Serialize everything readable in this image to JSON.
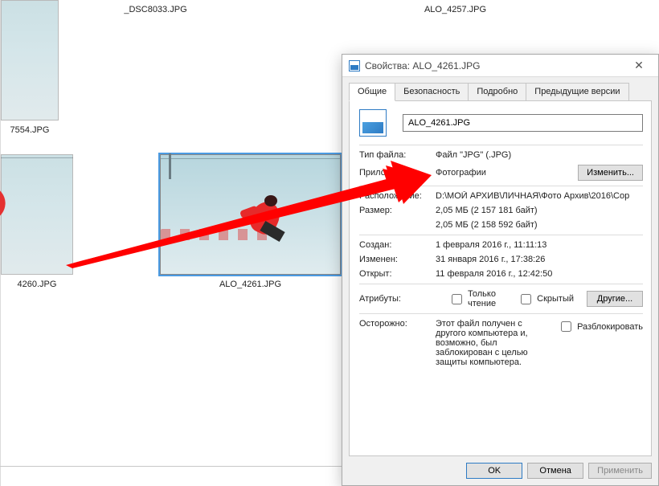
{
  "thumbs": {
    "top": [
      "7554.JPG",
      "_DSC8033.JPG",
      "ALO_4257.JPG"
    ],
    "row2_left": "4260.JPG",
    "main": "ALO_4261.JPG"
  },
  "dialog": {
    "title": "Свойства: ALO_4261.JPG",
    "tabs": [
      "Общие",
      "Безопасность",
      "Подробно",
      "Предыдущие версии"
    ],
    "filename": "ALO_4261.JPG",
    "props": {
      "type_k": "Тип файла:",
      "type_v": "Файл \"JPG\" (.JPG)",
      "app_k": "Приложение:",
      "app_v": "Фотографии",
      "change_btn": "Изменить...",
      "loc_k": "Расположение:",
      "loc_v": "D:\\МОЙ АРХИВ\\ЛИЧНАЯ\\Фото Архив\\2016\\Cop",
      "size_k": "Размер:",
      "size_v": "2,05 МБ (2 157 181 байт)",
      "disk_v": "2,05 МБ (2 158 592 байт)",
      "created_k": "Создан:",
      "created_v": "1 февраля 2016 г., 11:11:13",
      "modified_k": "Изменен:",
      "modified_v": "31 января 2016 г., 17:38:26",
      "opened_k": "Открыт:",
      "opened_v": "11 февраля 2016 г., 12:42:50",
      "attr_k": "Атрибуты:",
      "readonly": "Только чтение",
      "hidden": "Скрытый",
      "other_btn": "Другие...",
      "warn_k": "Осторожно:",
      "warn_v": "Этот файл получен с другого компьютера и, возможно, был заблокирован с целью защиты компьютера.",
      "unblock": "Разблокировать"
    },
    "buttons": {
      "ok": "OK",
      "cancel": "Отмена",
      "apply": "Применить"
    }
  }
}
